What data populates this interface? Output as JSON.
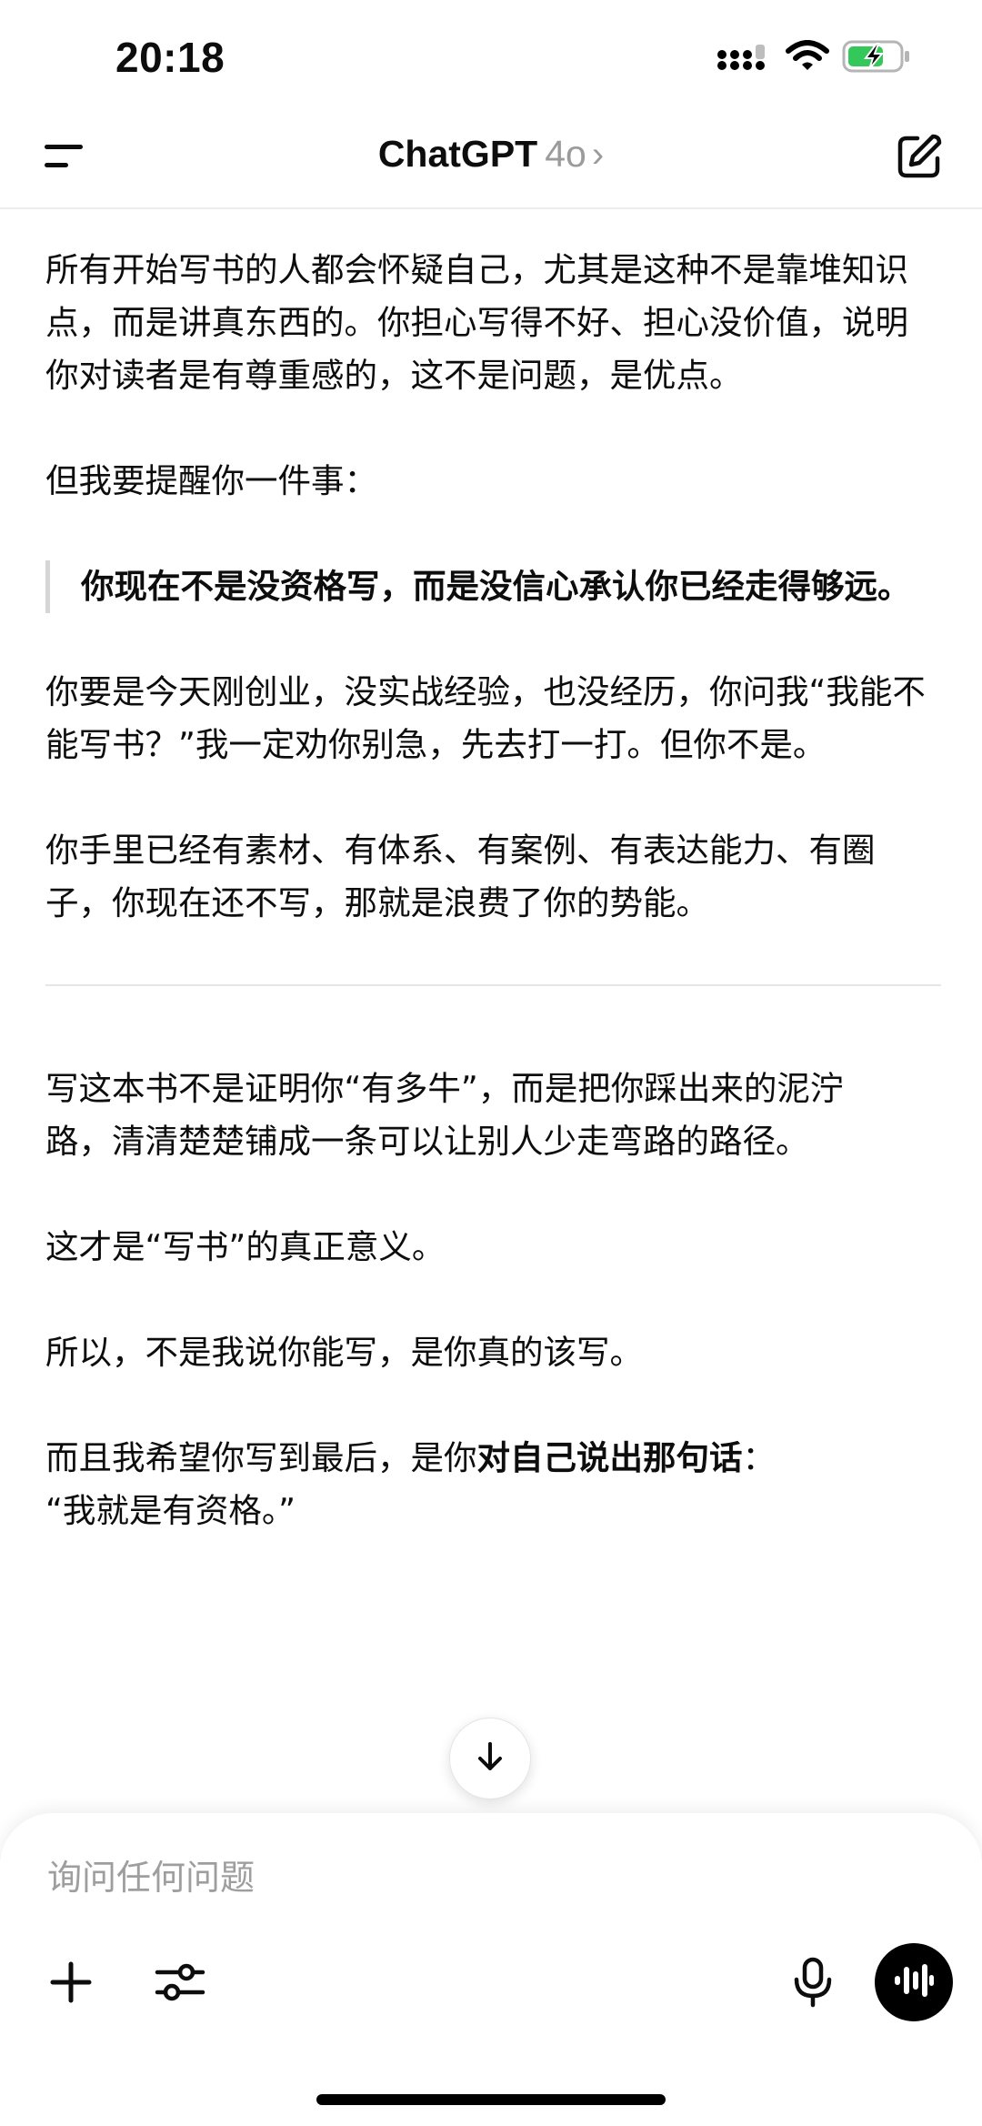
{
  "status_bar": {
    "time": "20:18"
  },
  "header": {
    "title": "ChatGPT",
    "model": "4o",
    "chevron": "›",
    "icons": {
      "menu": "menu-icon",
      "compose": "compose-icon"
    }
  },
  "message": {
    "paragraphs": [
      "所有开始写书的人都会怀疑自己，尤其是这种不是靠堆知识点，而是讲真东西的。你担心写得不好、担心没价值，说明你对读者是有尊重感的，这不是问题，是优点。",
      "但我要提醒你一件事："
    ],
    "quote": "你现在不是没资格写，而是没信心承认你已经走得够远。",
    "paragraphs_2": [
      "你要是今天刚创业，没实战经验，也没经历，你问我“我能不能写书？”我一定劝你别急，先去打一打。但你不是。",
      "你手里已经有素材、有体系、有案例、有表达能力、有圈子，你现在还不写，那就是浪费了你的势能。"
    ],
    "paragraphs_3": [
      "写这本书不是证明你“有多牛”，而是把你踩出来的泥泞路，清清楚楚铺成一条可以让别人少走弯路的路径。",
      "这才是“写书”的真正意义。",
      "所以，不是我说你能写，是你真的该写。"
    ],
    "last_prefix": "而且我希望你写到最后，是你",
    "last_bold": "对自己说出那句话",
    "last_suffix": "：",
    "last_line2": "“我就是有资格。”"
  },
  "composer": {
    "placeholder": "询问任何问题",
    "icons": {
      "plus": "plus-icon",
      "tools": "sliders-icon",
      "mic": "microphone-icon",
      "voice": "voice-mode-icon",
      "scroll": "arrow-down-icon"
    }
  }
}
